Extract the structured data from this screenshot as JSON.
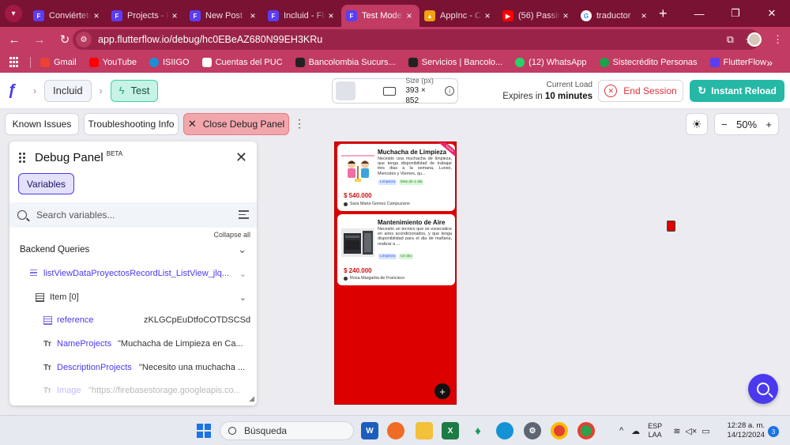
{
  "browser": {
    "tabs": [
      {
        "label": "Conviértete",
        "color": "#5b3df5",
        "glyph": "F"
      },
      {
        "label": "Projects - FlutterFlow",
        "color": "#5b3df5",
        "glyph": "F"
      },
      {
        "label": "New Post",
        "color": "#5b3df5",
        "glyph": "F"
      },
      {
        "label": "Incluid - FlutterFlow",
        "color": "#5b3df5",
        "glyph": "F"
      },
      {
        "label": "Test Mode",
        "color": "#5b3df5",
        "glyph": "F"
      },
      {
        "label": "AppInc - Cloud",
        "color": "#f2a20c",
        "glyph": "▲"
      },
      {
        "label": "(56) Passing",
        "color": "#ff0000",
        "glyph": "▶"
      },
      {
        "label": "traductor",
        "color": "#ffffff",
        "glyph": "G"
      }
    ],
    "url": "app.flutterflow.io/debug/hc0EBeAZ680N99EH3KRu",
    "bookmarks": [
      {
        "label": "Gmail",
        "color": "#ea4335"
      },
      {
        "label": "YouTube",
        "color": "#ff0000"
      },
      {
        "label": "ISIIGO",
        "color": "#1a8fd8"
      },
      {
        "label": "Cuentas del PUC",
        "color": "#ffffff"
      },
      {
        "label": "Bancolombia Sucurs...",
        "color": "#222222"
      },
      {
        "label": "Servicios | Bancolo...",
        "color": "#222222"
      },
      {
        "label": "(12) WhatsApp",
        "color": "#25d366"
      },
      {
        "label": "Sistecrédito Personas",
        "color": "#1aa34a"
      },
      {
        "label": "FlutterFlow",
        "color": "#5b3df5"
      }
    ]
  },
  "header": {
    "project": "Incluid",
    "mode": "Test",
    "size_label": "Size (px)",
    "size_value": "393 × 852",
    "current_load": "Current Load",
    "expires_prefix": "Expires in",
    "expires_value": "10 minutes",
    "end_session": "End Session",
    "instant_reload": "Instant Reload"
  },
  "subtoolbar": {
    "known_issues": "Known Issues",
    "troubleshooting": "Troubleshooting Info",
    "close_debug": "Close Debug Panel",
    "zoom": "50%"
  },
  "debug_panel": {
    "title": "Debug Panel",
    "beta": "BETA",
    "tab": "Variables",
    "search_placeholder": "Search variables...",
    "collapse_all": "Collapse all",
    "section": "Backend Queries",
    "query": "listViewDataProyectosRecordList_ListView_jlq...",
    "item": "Item [0]",
    "fields": [
      {
        "name": "reference",
        "value": "zKLGCpEuDtfoCOTDSCSd"
      },
      {
        "name": "NameProjects",
        "value": "\"Muchacha de Limpieza en Ca..."
      },
      {
        "name": "DescriptionProjects",
        "value": "\"Necesito una muchacha ..."
      },
      {
        "name": "Image",
        "value": "\"https://firebasestorage.googleapis.co..."
      }
    ]
  },
  "preview": {
    "ribbon": "Nuevo",
    "cards": [
      {
        "title": "Muchacha de Limpieza",
        "desc": "Necesito una muchacha de limpieza, que tenga disponibilidad de trabajar tres dias a la semana, Lunes, Miercoles y Viernes, qu...",
        "tag1": "Limpieza",
        "tag2": "Mas de 1 dia",
        "price": "$ 540.000",
        "person": "Sara Maria Gomez Campuzano"
      },
      {
        "title": "Mantenimiento de Aire",
        "desc": "Necesito un tecnico que se esoecialice en aires acondicionados, y que tenga disponibilidad para el dia de mañana, realizar a ...",
        "tag1": "Limpieza",
        "tag2": "Un dia",
        "price": "$ 240.000",
        "person": "Rosa Margarita de Francisco"
      }
    ],
    "fab": "+"
  },
  "taskbar": {
    "search": "Búsqueda",
    "lang1": "ESP",
    "lang2": "LAA",
    "time": "12:28 a. m.",
    "date": "14/12/2024",
    "notifications": "3"
  },
  "colors": {
    "brand": "#4b39ef",
    "accent_teal": "#26b8a6",
    "danger": "#e0323a",
    "browser_frame": "#c13b63"
  }
}
